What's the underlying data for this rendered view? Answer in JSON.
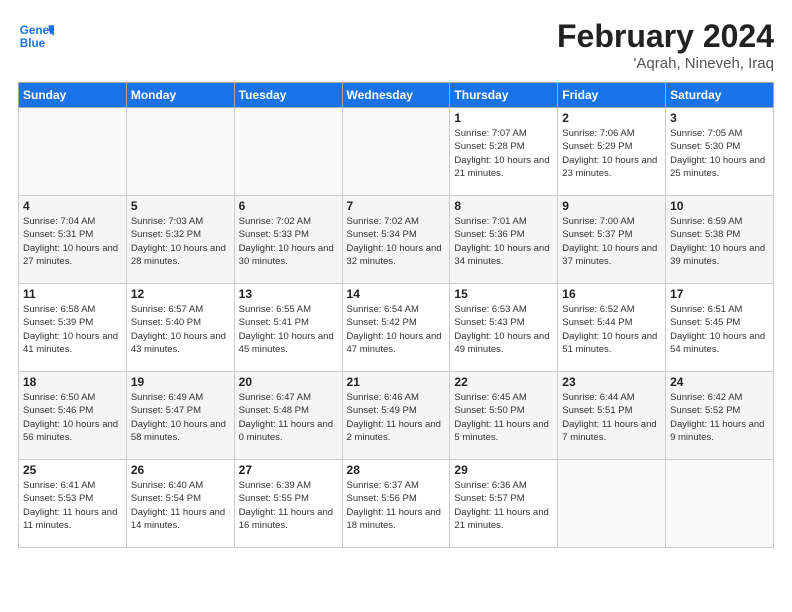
{
  "header": {
    "logo_general": "General",
    "logo_blue": "Blue",
    "month_year": "February 2024",
    "location": "'Aqrah, Nineveh, Iraq"
  },
  "days_of_week": [
    "Sunday",
    "Monday",
    "Tuesday",
    "Wednesday",
    "Thursday",
    "Friday",
    "Saturday"
  ],
  "weeks": [
    [
      {
        "day": "",
        "sunrise": "",
        "sunset": "",
        "daylight": ""
      },
      {
        "day": "",
        "sunrise": "",
        "sunset": "",
        "daylight": ""
      },
      {
        "day": "",
        "sunrise": "",
        "sunset": "",
        "daylight": ""
      },
      {
        "day": "",
        "sunrise": "",
        "sunset": "",
        "daylight": ""
      },
      {
        "day": "1",
        "sunrise": "7:07 AM",
        "sunset": "5:28 PM",
        "daylight": "10 hours and 21 minutes."
      },
      {
        "day": "2",
        "sunrise": "7:06 AM",
        "sunset": "5:29 PM",
        "daylight": "10 hours and 23 minutes."
      },
      {
        "day": "3",
        "sunrise": "7:05 AM",
        "sunset": "5:30 PM",
        "daylight": "10 hours and 25 minutes."
      }
    ],
    [
      {
        "day": "4",
        "sunrise": "7:04 AM",
        "sunset": "5:31 PM",
        "daylight": "10 hours and 27 minutes."
      },
      {
        "day": "5",
        "sunrise": "7:03 AM",
        "sunset": "5:32 PM",
        "daylight": "10 hours and 28 minutes."
      },
      {
        "day": "6",
        "sunrise": "7:02 AM",
        "sunset": "5:33 PM",
        "daylight": "10 hours and 30 minutes."
      },
      {
        "day": "7",
        "sunrise": "7:02 AM",
        "sunset": "5:34 PM",
        "daylight": "10 hours and 32 minutes."
      },
      {
        "day": "8",
        "sunrise": "7:01 AM",
        "sunset": "5:36 PM",
        "daylight": "10 hours and 34 minutes."
      },
      {
        "day": "9",
        "sunrise": "7:00 AM",
        "sunset": "5:37 PM",
        "daylight": "10 hours and 37 minutes."
      },
      {
        "day": "10",
        "sunrise": "6:59 AM",
        "sunset": "5:38 PM",
        "daylight": "10 hours and 39 minutes."
      }
    ],
    [
      {
        "day": "11",
        "sunrise": "6:58 AM",
        "sunset": "5:39 PM",
        "daylight": "10 hours and 41 minutes."
      },
      {
        "day": "12",
        "sunrise": "6:57 AM",
        "sunset": "5:40 PM",
        "daylight": "10 hours and 43 minutes."
      },
      {
        "day": "13",
        "sunrise": "6:55 AM",
        "sunset": "5:41 PM",
        "daylight": "10 hours and 45 minutes."
      },
      {
        "day": "14",
        "sunrise": "6:54 AM",
        "sunset": "5:42 PM",
        "daylight": "10 hours and 47 minutes."
      },
      {
        "day": "15",
        "sunrise": "6:53 AM",
        "sunset": "5:43 PM",
        "daylight": "10 hours and 49 minutes."
      },
      {
        "day": "16",
        "sunrise": "6:52 AM",
        "sunset": "5:44 PM",
        "daylight": "10 hours and 51 minutes."
      },
      {
        "day": "17",
        "sunrise": "6:51 AM",
        "sunset": "5:45 PM",
        "daylight": "10 hours and 54 minutes."
      }
    ],
    [
      {
        "day": "18",
        "sunrise": "6:50 AM",
        "sunset": "5:46 PM",
        "daylight": "10 hours and 56 minutes."
      },
      {
        "day": "19",
        "sunrise": "6:49 AM",
        "sunset": "5:47 PM",
        "daylight": "10 hours and 58 minutes."
      },
      {
        "day": "20",
        "sunrise": "6:47 AM",
        "sunset": "5:48 PM",
        "daylight": "11 hours and 0 minutes."
      },
      {
        "day": "21",
        "sunrise": "6:46 AM",
        "sunset": "5:49 PM",
        "daylight": "11 hours and 2 minutes."
      },
      {
        "day": "22",
        "sunrise": "6:45 AM",
        "sunset": "5:50 PM",
        "daylight": "11 hours and 5 minutes."
      },
      {
        "day": "23",
        "sunrise": "6:44 AM",
        "sunset": "5:51 PM",
        "daylight": "11 hours and 7 minutes."
      },
      {
        "day": "24",
        "sunrise": "6:42 AM",
        "sunset": "5:52 PM",
        "daylight": "11 hours and 9 minutes."
      }
    ],
    [
      {
        "day": "25",
        "sunrise": "6:41 AM",
        "sunset": "5:53 PM",
        "daylight": "11 hours and 11 minutes."
      },
      {
        "day": "26",
        "sunrise": "6:40 AM",
        "sunset": "5:54 PM",
        "daylight": "11 hours and 14 minutes."
      },
      {
        "day": "27",
        "sunrise": "6:39 AM",
        "sunset": "5:55 PM",
        "daylight": "11 hours and 16 minutes."
      },
      {
        "day": "28",
        "sunrise": "6:37 AM",
        "sunset": "5:56 PM",
        "daylight": "11 hours and 18 minutes."
      },
      {
        "day": "29",
        "sunrise": "6:36 AM",
        "sunset": "5:57 PM",
        "daylight": "11 hours and 21 minutes."
      },
      {
        "day": "",
        "sunrise": "",
        "sunset": "",
        "daylight": ""
      },
      {
        "day": "",
        "sunrise": "",
        "sunset": "",
        "daylight": ""
      }
    ]
  ]
}
